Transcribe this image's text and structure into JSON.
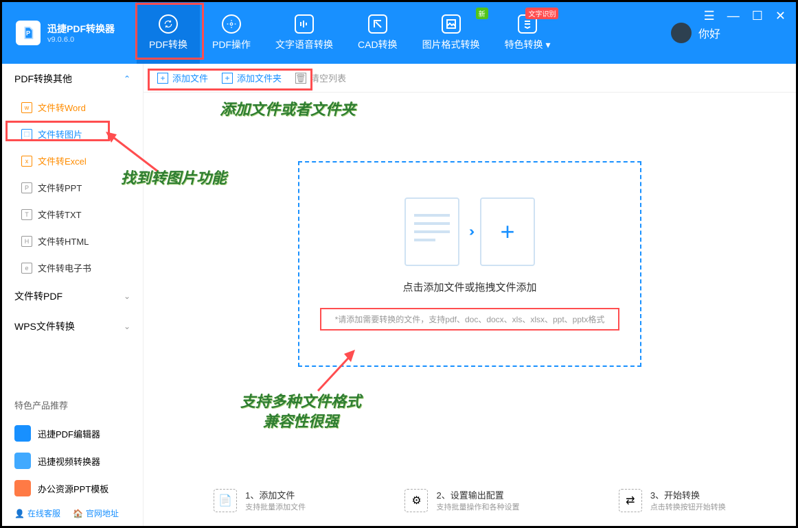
{
  "app": {
    "name": "迅捷PDF转换器",
    "version": "v9.0.6.0"
  },
  "tabs": [
    {
      "label": "PDF转换",
      "active": true
    },
    {
      "label": "PDF操作"
    },
    {
      "label": "文字语音转换"
    },
    {
      "label": "CAD转换"
    },
    {
      "label": "图片格式转换",
      "badge": "新"
    },
    {
      "label": "特色转换",
      "badge": "文字识别",
      "dropdown": true
    }
  ],
  "user": {
    "greeting": "你好"
  },
  "sidebar": {
    "sections": [
      {
        "title": "PDF转换其他",
        "expanded": true,
        "items": [
          {
            "label": "文件转Word",
            "ico": "w",
            "hl": true
          },
          {
            "label": "文件转图片",
            "ico": "⬚",
            "active": true
          },
          {
            "label": "文件转Excel",
            "ico": "x",
            "hl": true
          },
          {
            "label": "文件转PPT",
            "ico": "P"
          },
          {
            "label": "文件转TXT",
            "ico": "T"
          },
          {
            "label": "文件转HTML",
            "ico": "H"
          },
          {
            "label": "文件转电子书",
            "ico": "e"
          }
        ]
      },
      {
        "title": "文件转PDF",
        "expanded": false
      },
      {
        "title": "WPS文件转换",
        "expanded": false
      }
    ],
    "rec_title": "特色产品推荐",
    "recs": [
      {
        "label": "迅捷PDF编辑器",
        "color": "#1890ff"
      },
      {
        "label": "迅捷视频转换器",
        "color": "#40a9ff"
      },
      {
        "label": "办公资源PPT模板",
        "color": "#ff7a45"
      }
    ],
    "support": [
      {
        "label": "在线客服"
      },
      {
        "label": "官网地址"
      }
    ]
  },
  "toolbar": {
    "add_file": "添加文件",
    "add_folder": "添加文件夹",
    "clear": "清空列表"
  },
  "dropzone": {
    "title": "点击添加文件或拖拽文件添加",
    "sub": "*请添加需要转换的文件，支持pdf、doc、docx、xls、xlsx、ppt、pptx格式"
  },
  "steps": [
    {
      "t1": "1、添加文件",
      "t2": "支持批量添加文件"
    },
    {
      "t1": "2、设置输出配置",
      "t2": "支持批量操作和各种设置"
    },
    {
      "t1": "3、开始转换",
      "t2": "点击转换按钮开始转换"
    }
  ],
  "annotations": {
    "a1": "添加文件或者文件夹",
    "a2": "找到转图片功能",
    "a3": "支持多种文件格式",
    "a4": "兼容性很强"
  }
}
